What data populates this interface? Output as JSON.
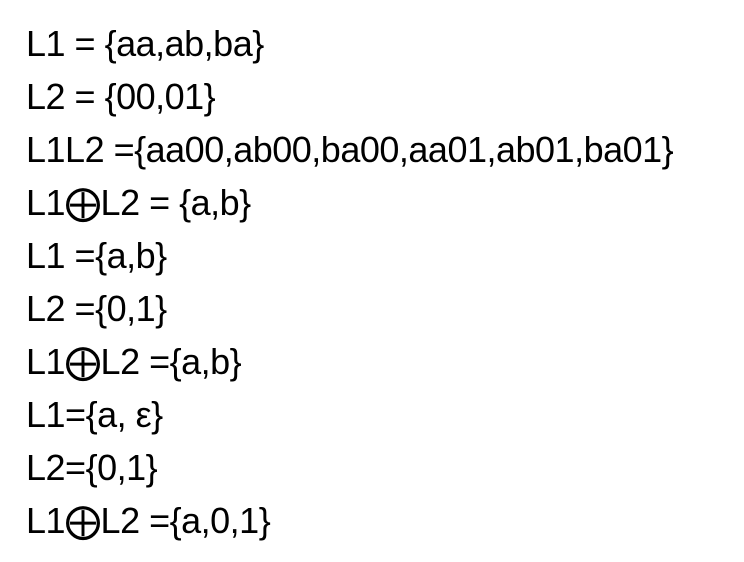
{
  "lines": [
    "L1 = {aa,ab,ba}",
    "L2 = {00,01}",
    "L1L2 ={aa00,ab00,ba00,aa01,ab01,ba01}",
    "L1⨁L2 = {a,b}",
    "L1 ={a,b}",
    "L2 ={0,1}",
    "L1⨁L2 ={a,b}",
    "L1={a, ε}",
    "L2={0,1}",
    "L1⨁L2 ={a,0,1}"
  ]
}
